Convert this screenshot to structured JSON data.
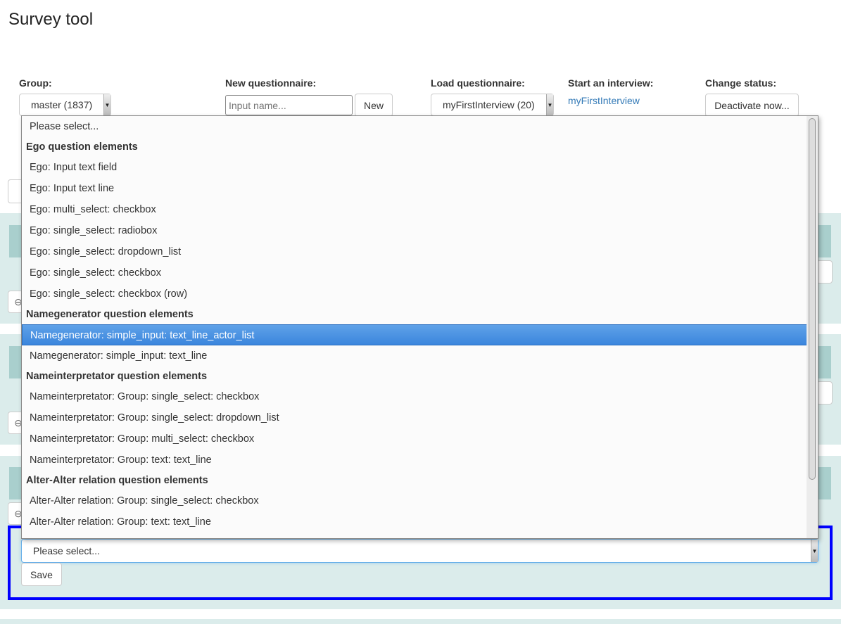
{
  "title": "Survey tool",
  "group": {
    "label": "Group:",
    "value": "master (1837)"
  },
  "new_questionnaire": {
    "label": "New questionnaire:",
    "placeholder": "Input name...",
    "button": "New"
  },
  "load_questionnaire": {
    "label": "Load questionnaire:",
    "value": "myFirstInterview (20)"
  },
  "start_interview": {
    "label": "Start an interview:",
    "link": "myFirstInterview"
  },
  "change_status": {
    "label": "Change status:",
    "button": "Deactivate now..."
  },
  "dropdown": {
    "items": [
      {
        "type": "option",
        "label": "Please select..."
      },
      {
        "type": "group",
        "label": "Ego question elements"
      },
      {
        "type": "option",
        "label": "Ego: Input text field"
      },
      {
        "type": "option",
        "label": "Ego: Input text line"
      },
      {
        "type": "option",
        "label": "Ego: multi_select: checkbox"
      },
      {
        "type": "option",
        "label": "Ego: single_select: radiobox"
      },
      {
        "type": "option",
        "label": "Ego: single_select: dropdown_list"
      },
      {
        "type": "option",
        "label": "Ego: single_select: checkbox"
      },
      {
        "type": "option",
        "label": "Ego: single_select: checkbox (row)"
      },
      {
        "type": "group",
        "label": "Namegenerator question elements"
      },
      {
        "type": "option",
        "label": "Namegenerator: simple_input: text_line_actor_list",
        "highlighted": true
      },
      {
        "type": "option",
        "label": "Namegenerator: simple_input: text_line"
      },
      {
        "type": "group",
        "label": "Nameinterpretator question elements"
      },
      {
        "type": "option",
        "label": "Nameinterpretator: Group: single_select: checkbox"
      },
      {
        "type": "option",
        "label": "Nameinterpretator: Group: single_select: dropdown_list"
      },
      {
        "type": "option",
        "label": "Nameinterpretator: Group: multi_select: checkbox"
      },
      {
        "type": "option",
        "label": "Nameinterpretator: Group: text: text_line"
      },
      {
        "type": "group",
        "label": "Alter-Alter relation question elements"
      },
      {
        "type": "option",
        "label": "Alter-Alter relation: Group: single_select: checkbox"
      },
      {
        "type": "option",
        "label": "Alter-Alter relation: Group: text: text_line"
      }
    ]
  },
  "new_element": {
    "select_value": "Please select...",
    "save": "Save"
  },
  "colors": {
    "panel": "#dbeceb",
    "panel_header": "#a9cfcd",
    "highlight": "#3b86dd",
    "focus_outline": "#0000ff",
    "link": "#337ab7"
  }
}
